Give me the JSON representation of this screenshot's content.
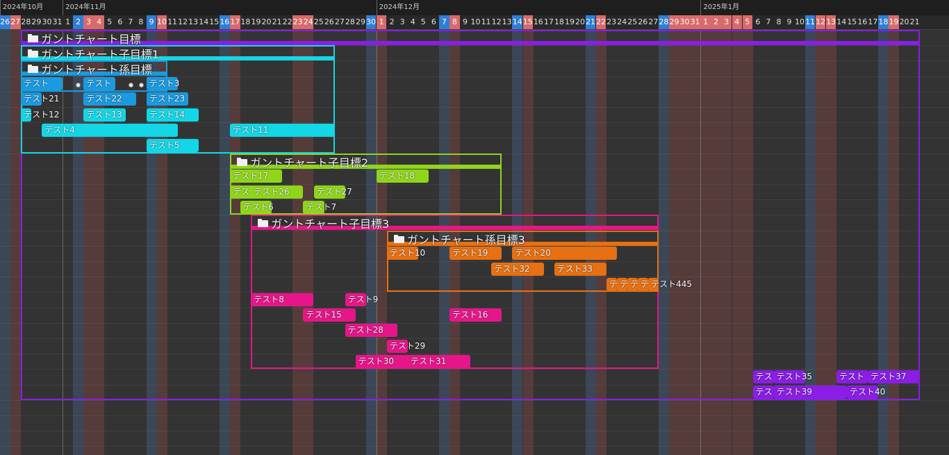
{
  "months": [
    {
      "label": "2024年10月",
      "start": "2024-10-26"
    },
    {
      "label": "2024年11月",
      "start": "2024-11-01"
    },
    {
      "label": "2024年12月",
      "start": "2024-12-01"
    },
    {
      "label": "2025年1月",
      "start": "2025-01-01"
    }
  ],
  "timeline": {
    "start": "2024-10-26",
    "end": "2025-01-21"
  },
  "weekend_colors": {
    "saturday": "#2f7ed6",
    "sunday_holiday": "#d86a6a"
  },
  "holidays": [
    "2024-11-04",
    "2024-11-23",
    "2024-12-29",
    "2024-12-30",
    "2024-12-31",
    "2025-01-01",
    "2025-01-02",
    "2025-01-03",
    "2025-01-04",
    "2025-01-05",
    "2025-01-12",
    "2025-01-13"
  ],
  "groups": [
    {
      "title": "ガントチャート目標",
      "color": "#8a1de6",
      "start": "2024-10-28",
      "end": "2025-01-21",
      "first_row": 0,
      "last_row": 23
    },
    {
      "title": "ガントチャート子目標1",
      "color": "#13d6e6",
      "start": "2024-10-28",
      "end": "2024-11-26",
      "first_row": 1,
      "last_row": 7
    },
    {
      "title": "ガントチャート孫目標",
      "color": "#1a9ae0",
      "start": "2024-10-28",
      "end": "2024-11-10",
      "first_row": 2,
      "last_row": 3
    },
    {
      "title": "ガントチャート子目標2",
      "color": "#8fd619",
      "start": "2024-11-17",
      "end": "2024-12-12",
      "first_row": 8,
      "last_row": 11
    },
    {
      "title": "ガントチャート子目標3",
      "color": "#e6168a",
      "start": "2024-11-19",
      "end": "2024-12-27",
      "first_row": 12,
      "last_row": 21
    },
    {
      "title": "ガントチャート孫目標3",
      "color": "#e67012",
      "start": "2024-12-02",
      "end": "2024-12-27",
      "first_row": 13,
      "last_row": 16
    }
  ],
  "tasks": [
    {
      "label": "テスト",
      "row": 3,
      "start": "2024-10-28",
      "end": "2024-10-31",
      "color": "#1a9ae0"
    },
    {
      "label": "テスト",
      "row": 3,
      "start": "2024-11-03",
      "end": "2024-11-05",
      "color": "#1a9ae0"
    },
    {
      "label": "テスト3",
      "row": 3,
      "start": "2024-11-09",
      "end": "2024-11-11",
      "color": "#1a9ae0"
    },
    {
      "label": "テスト21",
      "row": 4,
      "start": "2024-10-28",
      "end": "2024-10-29",
      "color": "#1a9ae0"
    },
    {
      "label": "テスト22",
      "row": 4,
      "start": "2024-11-03",
      "end": "2024-11-07",
      "color": "#1a9ae0"
    },
    {
      "label": "テスト23",
      "row": 4,
      "start": "2024-11-09",
      "end": "2024-11-12",
      "color": "#1a9ae0"
    },
    {
      "label": "テスト12",
      "row": 5,
      "start": "2024-10-28",
      "end": "2024-10-28",
      "color": "#13d6e6"
    },
    {
      "label": "テスト13",
      "row": 5,
      "start": "2024-11-03",
      "end": "2024-11-06",
      "color": "#13d6e6"
    },
    {
      "label": "テスト14",
      "row": 5,
      "start": "2024-11-09",
      "end": "2024-11-13",
      "color": "#13d6e6"
    },
    {
      "label": "テスト4",
      "row": 6,
      "start": "2024-10-30",
      "end": "2024-11-11",
      "color": "#13d6e6"
    },
    {
      "label": "テスト11",
      "row": 6,
      "start": "2024-11-17",
      "end": "2024-11-26",
      "color": "#13d6e6"
    },
    {
      "label": "テスト5",
      "row": 7,
      "start": "2024-11-09",
      "end": "2024-11-13",
      "color": "#13d6e6"
    },
    {
      "label": "テスト17",
      "row": 9,
      "start": "2024-11-17",
      "end": "2024-11-21",
      "color": "#8fd619"
    },
    {
      "label": "テスト18",
      "row": 9,
      "start": "2024-12-01",
      "end": "2024-12-05",
      "color": "#8fd619"
    },
    {
      "label": "テスト",
      "row": 10,
      "start": "2024-11-17",
      "end": "2024-11-19",
      "color": "#8fd619"
    },
    {
      "label": "テスト26",
      "row": 10,
      "start": "2024-11-19",
      "end": "2024-11-23",
      "color": "#8fd619"
    },
    {
      "label": "テスト27",
      "row": 10,
      "start": "2024-11-25",
      "end": "2024-11-27",
      "color": "#8fd619"
    },
    {
      "label": "テスト6",
      "row": 11,
      "start": "2024-11-18",
      "end": "2024-11-20",
      "color": "#8fd619"
    },
    {
      "label": "テスト7",
      "row": 11,
      "start": "2024-11-24",
      "end": "2024-11-25",
      "color": "#8fd619"
    },
    {
      "label": "テスト10",
      "row": 14,
      "start": "2024-12-02",
      "end": "2024-12-04",
      "color": "#e67012"
    },
    {
      "label": "テスト19",
      "row": 14,
      "start": "2024-12-08",
      "end": "2024-12-12",
      "color": "#e67012"
    },
    {
      "label": "テスト20",
      "row": 14,
      "start": "2024-12-14",
      "end": "2024-12-23",
      "color": "#e67012"
    },
    {
      "label": "テスト32",
      "row": 15,
      "start": "2024-12-12",
      "end": "2024-12-16",
      "color": "#e67012"
    },
    {
      "label": "テスト33",
      "row": 15,
      "start": "2024-12-18",
      "end": "2024-12-22",
      "color": "#e67012"
    },
    {
      "label": "テ",
      "row": 16,
      "start": "2024-12-23",
      "end": "2024-12-23",
      "color": "#e67012"
    },
    {
      "label": "テ",
      "row": 16,
      "start": "2024-12-24",
      "end": "2024-12-24",
      "color": "#e67012"
    },
    {
      "label": "テ",
      "row": 16,
      "start": "2024-12-25",
      "end": "2024-12-25",
      "color": "#e67012"
    },
    {
      "label": "テ",
      "row": 16,
      "start": "2024-12-26",
      "end": "2024-12-26",
      "color": "#e67012"
    },
    {
      "label": "テスト445",
      "row": 16,
      "start": "2024-12-27",
      "end": "2024-12-27",
      "color": "#e67012"
    },
    {
      "label": "テスト8",
      "row": 17,
      "start": "2024-11-19",
      "end": "2024-11-24",
      "color": "#e6168a"
    },
    {
      "label": "テスト9",
      "row": 17,
      "start": "2024-11-28",
      "end": "2024-11-29",
      "color": "#e6168a"
    },
    {
      "label": "テスト15",
      "row": 18,
      "start": "2024-11-24",
      "end": "2024-11-28",
      "color": "#e6168a"
    },
    {
      "label": "テスト16",
      "row": 18,
      "start": "2024-12-08",
      "end": "2024-12-12",
      "color": "#e6168a"
    },
    {
      "label": "テスト28",
      "row": 19,
      "start": "2024-11-28",
      "end": "2024-12-02",
      "color": "#e6168a"
    },
    {
      "label": "テスト29",
      "row": 20,
      "start": "2024-12-02",
      "end": "2024-12-03",
      "color": "#e6168a"
    },
    {
      "label": "テスト30",
      "row": 21,
      "start": "2024-11-29",
      "end": "2024-12-04",
      "color": "#e6168a"
    },
    {
      "label": "テスト31",
      "row": 21,
      "start": "2024-12-04",
      "end": "2024-12-09",
      "color": "#e6168a"
    },
    {
      "label": "テス",
      "row": 22,
      "start": "2025-01-06",
      "end": "2025-01-07",
      "color": "#8a1de6"
    },
    {
      "label": "テスト35",
      "row": 22,
      "start": "2025-01-08",
      "end": "2025-01-10",
      "color": "#8a1de6"
    },
    {
      "label": "テスト",
      "row": 22,
      "start": "2025-01-14",
      "end": "2025-01-16",
      "color": "#8a1de6"
    },
    {
      "label": "テスト37",
      "row": 22,
      "start": "2025-01-17",
      "end": "2025-01-21",
      "color": "#8a1de6"
    },
    {
      "label": "テスト",
      "row": 23,
      "start": "2025-01-06",
      "end": "2025-01-07",
      "color": "#8a1de6"
    },
    {
      "label": "テスト39",
      "row": 23,
      "start": "2025-01-08",
      "end": "2025-01-14",
      "color": "#8a1de6"
    },
    {
      "label": "テスト40",
      "row": 23,
      "start": "2025-01-15",
      "end": "2025-01-17",
      "color": "#8a1de6"
    }
  ],
  "milestones": [
    {
      "row": 3,
      "date": "2024-11-02"
    },
    {
      "row": 3,
      "date": "2024-11-07"
    },
    {
      "row": 3,
      "date": "2024-11-08"
    }
  ]
}
